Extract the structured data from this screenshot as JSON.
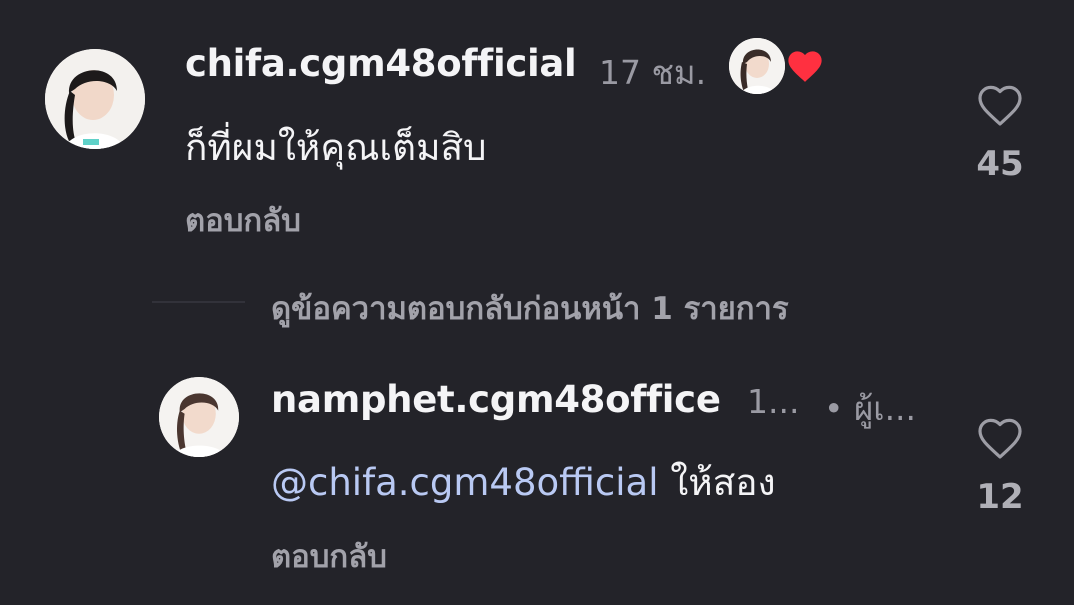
{
  "comment": {
    "username": "chifa.cgm48official",
    "time": "17 ชม.",
    "text": "ก็ที่ผมให้คุณเต็มสิบ",
    "reply_label": "ตอบกลับ",
    "like_count": "45",
    "author_liked_icon": "red-heart-icon"
  },
  "view_replies": "ดูข้อความตอบกลับก่อนหน้า 1 รายการ",
  "reply": {
    "username": "namphet.cgm48office",
    "time": "1...",
    "role": "• ผู้เ...",
    "mention": "@chifa.cgm48official",
    "text": " ให้สอง",
    "reply_label": "ตอบกลับ",
    "like_count": "12"
  },
  "colors": {
    "background": "#232329",
    "text": "#f4f4f6",
    "muted": "#9a9aa3",
    "mention": "#b9c9f3",
    "heart": "#ff3040"
  }
}
